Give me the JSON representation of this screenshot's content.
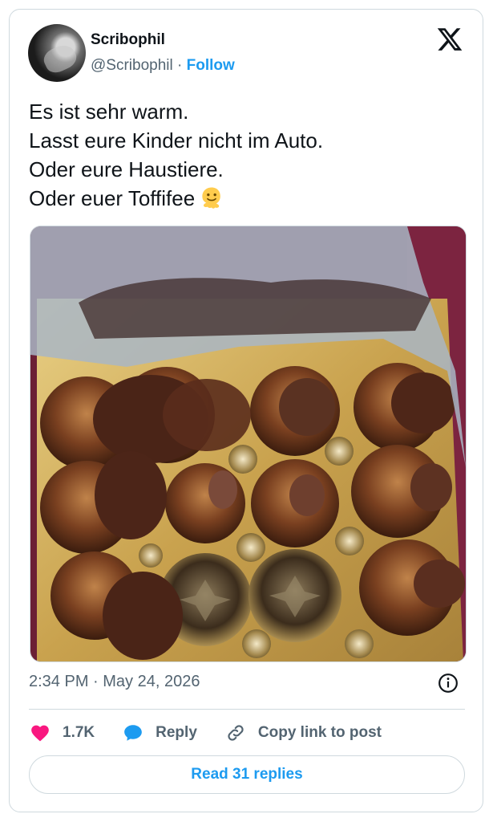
{
  "author": {
    "name": "Scribophil",
    "handle": "@Scribophil",
    "separator": "·",
    "follow_label": "Follow"
  },
  "tweet": {
    "text": "Es ist sehr warm.\nLasst eure Kinder nicht im Auto.\nOder eure Haustiere.\nOder euer Toffifee",
    "emoji_icon": "melting-face-icon"
  },
  "meta": {
    "timestamp": "2:34 PM · May 24, 2026"
  },
  "actions": {
    "like_count": "1.7K",
    "reply_label": "Reply",
    "copy_label": "Copy link to post"
  },
  "footer": {
    "read_replies_label": "Read 31 replies"
  },
  "colors": {
    "accent": "#1d9bf0",
    "like": "#f91880",
    "muted": "#536471",
    "border": "#cfd9de"
  }
}
